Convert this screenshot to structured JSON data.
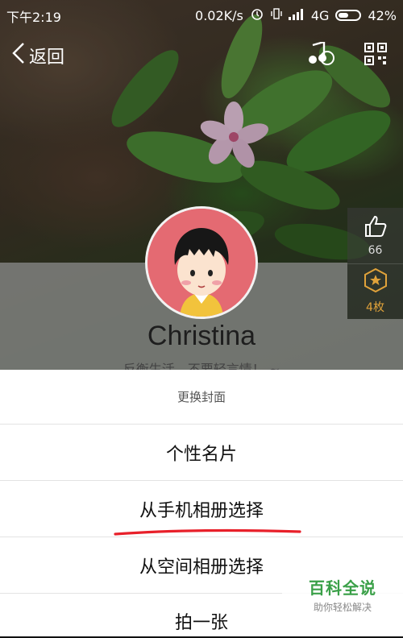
{
  "status_bar": {
    "time": "下午2:19",
    "network_speed": "0.02K/s",
    "network_type": "4G",
    "battery": "42%"
  },
  "nav": {
    "back_label": "返回",
    "music_icon": "music-note-icon",
    "qr_icon": "qr-code-icon"
  },
  "side": {
    "like_count": "66",
    "badge_count": "4枚"
  },
  "profile": {
    "name": "Christina",
    "signature": "反衡生活，不要轻言情！ ~"
  },
  "sheet": {
    "title": "更换封面",
    "items": [
      {
        "label": "个性名片"
      },
      {
        "label": "从手机相册选择"
      },
      {
        "label": "从空间相册选择"
      },
      {
        "label": "拍一张"
      }
    ]
  },
  "watermark": {
    "title": "百科全说",
    "subtitle": "助你轻松解决"
  },
  "colors": {
    "sheet_bg": "#ffffff",
    "annotation_red": "#e8202a",
    "badge_gold": "#e0a23a",
    "watermark_green": "#3aa048"
  }
}
